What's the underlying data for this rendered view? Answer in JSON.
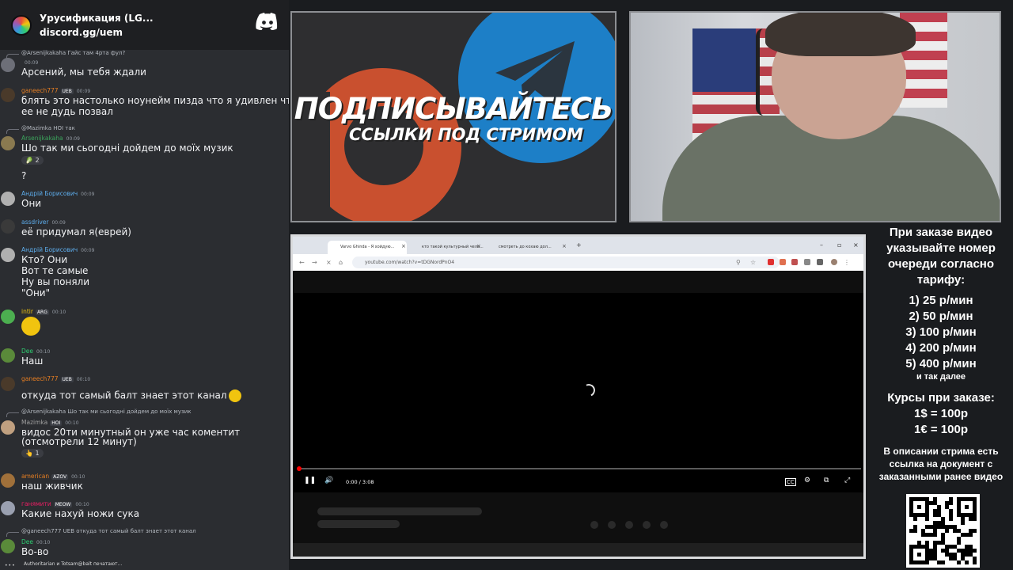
{
  "chat": {
    "server_name": "Урусификация (LG...",
    "server_invite": "discord.gg/uem",
    "messages": [
      {
        "reply": "@Arsenijkakaha Гайс там 4рта фул?",
        "user": "",
        "time": "00:09",
        "text": "Арсений, мы тебя ждали",
        "color": "#7fc97f"
      },
      {
        "user": "ganeech777",
        "badge": "UEB",
        "time": "00:09",
        "text": "блять это настолько ноунейм пизда что я удивлен что\nее не дудь позвал",
        "color": "#e67e22"
      },
      {
        "reply": "@Mazimka HOI так",
        "user": "Arsenijkakaha",
        "time": "00:09",
        "text": "Шо так ми сьогодні дойдем до моїх музик",
        "color": "#3ba55c",
        "reaction": "2"
      },
      {
        "text": "?"
      },
      {
        "user": "Андрій Борисович",
        "time": "00:09",
        "text": "Они",
        "color": "#5dadec"
      },
      {
        "user": "assdriver",
        "time": "00:09",
        "text": "её придумал я(еврей)",
        "color": "#5dadec"
      },
      {
        "user": "Андрій Борисович",
        "time": "00:09",
        "text": "Кто? Они\nВот те самые\nНу вы поняли\n\"Они\"",
        "color": "#5dadec"
      },
      {
        "user": "intir",
        "badge": "ARG",
        "time": "00:10",
        "text": "",
        "color": "#f1c40f"
      },
      {
        "user": "Dee",
        "time": "00:10",
        "text": "Наш",
        "color": "#2ecc71"
      },
      {
        "user": "ganeech777",
        "badge": "UEB",
        "time": "00:10",
        "text": "откуда тот самый балт знает этот канал",
        "color": "#e67e22"
      },
      {
        "reply": "@Arsenijkakaha Шо так ми сьогодні дойдем до моїх музик",
        "user": "Mazimka",
        "badge": "HOI",
        "time": "00:10",
        "text": "видос 20ти минутный он уже час коментит\n(отсмотрели 12 минут)",
        "color": "#a0a0a0",
        "reaction": "1"
      },
      {
        "user": "american",
        "badge": "AZOV",
        "time": "00:10",
        "text": "наш живчик",
        "color": "#e67e22"
      },
      {
        "user": "ганямити",
        "badge": "MEOW",
        "time": "00:10",
        "text": "Какие нахуй ножи сука",
        "color": "#e91e63"
      },
      {
        "reply": "@ganeech777 UEB откуда тот самый балт знает этот канал",
        "user": "Dee",
        "time": "00:10",
        "text": "Во-во",
        "color": "#2ecc71"
      }
    ],
    "typing": "Authoritarian и Totsam@balt печатают..."
  },
  "banner": {
    "title": "ПОДПИСЫВАЙТЕСЬ",
    "subtitle": "ССЫЛКИ ПОД СТРИМОМ"
  },
  "browser": {
    "tabs": [
      "Varvo Ghinda - Я хойдую...",
      "кто такой культурный чело...",
      "смотреть до кохаю дол..."
    ],
    "url": "youtube.com/watch?v=tDGNordPnO4",
    "time": "0:00 / 3:08"
  },
  "info": {
    "head": "При заказе видео указывайте номер очереди согласно тарифу:",
    "rates": [
      "1) 25 р/мин",
      "2) 50 р/мин",
      "3) 100 р/мин",
      "4) 200 р/мин",
      "5) 400 р/мин"
    ],
    "rates_more": "и так далее",
    "course_head": "Курсы при заказе:",
    "courses": [
      "1$ = 100р",
      "1€ = 100р"
    ],
    "desc": "В описании стрима есть ссылка на документ с заказанными ранее видео"
  }
}
